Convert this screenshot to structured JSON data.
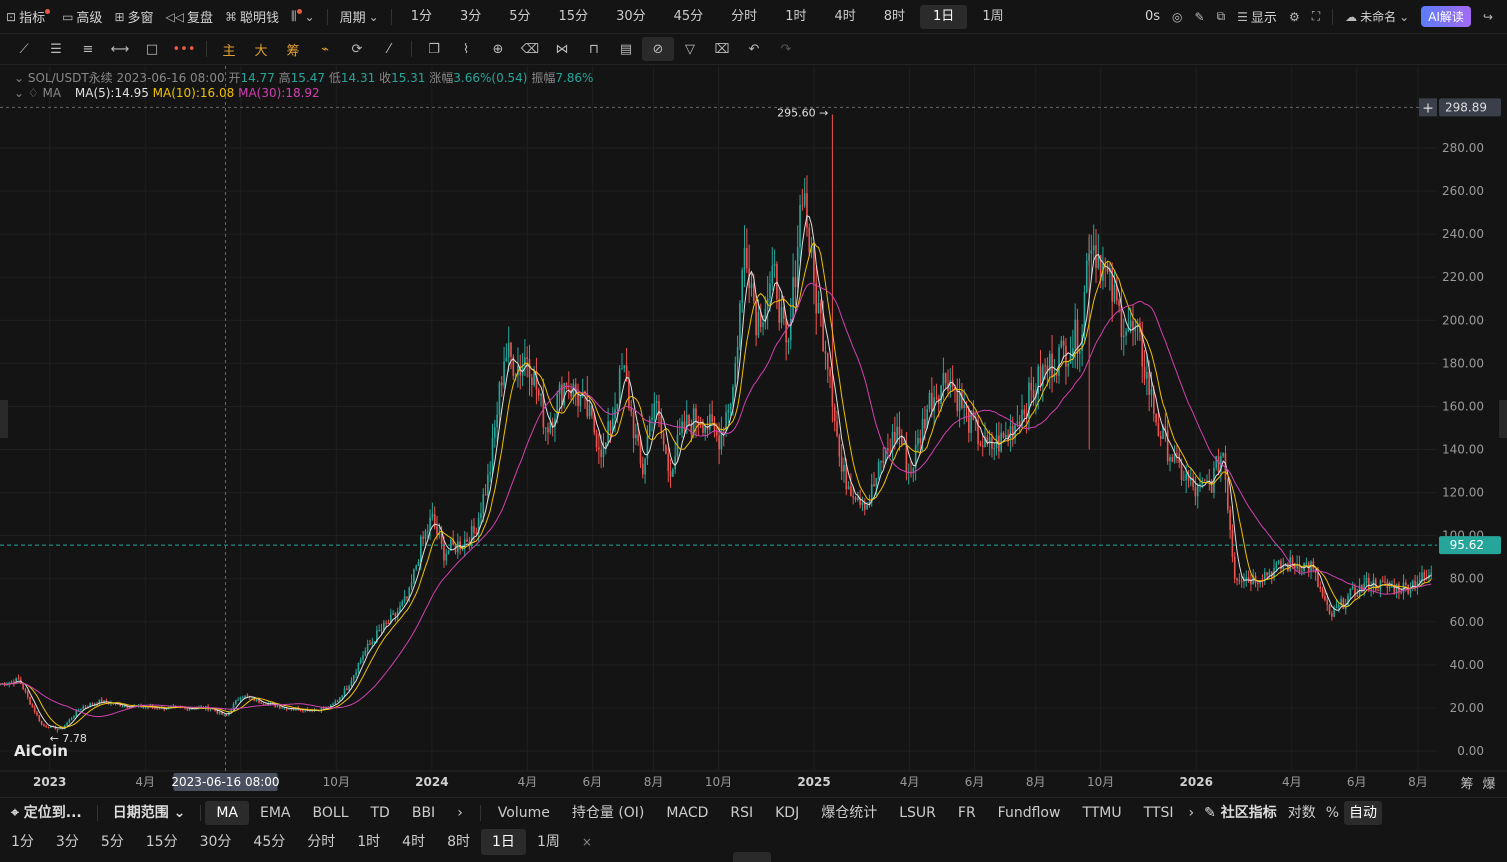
{
  "topbar": {
    "indicators": "指标",
    "advanced": "高级",
    "multi_window": "多窗",
    "replay": "复盘",
    "smart_money": "聪明钱",
    "period_menu": "周期",
    "periods": [
      "1分",
      "3分",
      "5分",
      "15分",
      "30分",
      "45分",
      "分时",
      "1时",
      "4时",
      "8时",
      "1日",
      "1周"
    ],
    "active_period": "1日",
    "countdown": "0s",
    "display": "显示",
    "layout_name": "未命名",
    "ai_button": "AI解读"
  },
  "drawbar": {
    "main_label": "主",
    "big_label": "大",
    "chip_label": "筹"
  },
  "legend": {
    "symbol": "SOL/USDT永续",
    "date": "2023-06-16 08:00",
    "open_label": "开",
    "open": "14.77",
    "high_label": "高",
    "high": "15.47",
    "low_label": "低",
    "low": "14.31",
    "close_label": "收",
    "close": "15.31",
    "change_label": "涨幅",
    "change": "3.66%(0.54)",
    "amp_label": "振幅",
    "amp": "7.86%",
    "ma_name": "MA",
    "ma5": "MA(5):14.95",
    "ma10": "MA(10):16.08",
    "ma30": "MA(30):18.92"
  },
  "chart_data": {
    "type": "line",
    "title": "SOL/USDT永续",
    "interval": "1日",
    "ylim": [
      0,
      300
    ],
    "y_ticks": [
      "0.00",
      "20.00",
      "40.00",
      "60.00",
      "80.00",
      "100.00",
      "120.00",
      "140.00",
      "160.00",
      "180.00",
      "200.00",
      "220.00",
      "240.00",
      "260.00",
      "280.00"
    ],
    "x_ticks": [
      "2023",
      "4月",
      "7月",
      "10月",
      "2024",
      "4月",
      "6月",
      "8月",
      "10月",
      "2025",
      "4月",
      "6月",
      "8月",
      "10月",
      "2026",
      "4月",
      "6月",
      "8月"
    ],
    "x_tick_dates": [
      2023.0,
      2023.25,
      2023.5,
      2023.75,
      2024.0,
      2024.25,
      2024.42,
      2024.58,
      2024.75,
      2025.0,
      2025.25,
      2025.42,
      2025.58,
      2025.75,
      2026.0,
      2026.25,
      2026.42,
      2026.58
    ],
    "x_range": [
      2022.87,
      2026.63
    ],
    "series": [
      {
        "name": "SOL/USDT永续",
        "color": "#26a69a",
        "x": [
          2022.87,
          2022.92,
          2022.95,
          2022.98,
          2023.03,
          2023.08,
          2023.13,
          2023.2,
          2023.3,
          2023.42,
          2023.46,
          2023.5,
          2023.55,
          2023.62,
          2023.7,
          2023.74,
          2023.78,
          2023.82,
          2023.86,
          2023.9,
          2023.94,
          2023.97,
          2024.0,
          2024.03,
          2024.07,
          2024.11,
          2024.15,
          2024.19,
          2024.23,
          2024.25,
          2024.3,
          2024.35,
          2024.4,
          2024.45,
          2024.5,
          2024.55,
          2024.58,
          2024.62,
          2024.66,
          2024.7,
          2024.75,
          2024.79,
          2024.82,
          2024.85,
          2024.88,
          2024.9,
          2024.93,
          2024.97,
          2025.0,
          2025.04,
          2025.07,
          2025.1,
          2025.14,
          2025.18,
          2025.22,
          2025.25,
          2025.3,
          2025.35,
          2025.4,
          2025.45,
          2025.5,
          2025.55,
          2025.6,
          2025.65,
          2025.7,
          2025.72,
          2025.75,
          2025.8,
          2025.85,
          2025.9,
          2025.95,
          2026.0,
          2026.04,
          2026.07,
          2026.1,
          2026.15,
          2026.2,
          2026.25,
          2026.3,
          2026.35,
          2026.4,
          2026.45,
          2026.5,
          2026.55,
          2026.58,
          2026.61,
          2026.63
        ],
        "y": [
          31,
          33,
          22,
          12,
          10,
          20,
          23,
          21,
          20,
          20,
          16,
          26,
          23,
          20,
          19,
          21,
          30,
          45,
          55,
          62,
          72,
          95,
          108,
          92,
          96,
          101,
          128,
          185,
          178,
          185,
          150,
          172,
          160,
          138,
          178,
          128,
          165,
          130,
          150,
          156,
          145,
          170,
          238,
          200,
          212,
          220,
          180,
          265,
          215,
          180,
          130,
          122,
          115,
          135,
          150,
          128,
          162,
          175,
          155,
          140,
          145,
          160,
          176,
          185,
          195,
          240,
          228,
          202,
          190,
          150,
          132,
          120,
          125,
          140,
          82,
          80,
          84,
          87,
          86,
          62,
          72,
          78,
          76,
          76,
          80,
          80,
          96
        ]
      },
      {
        "name": "MA(5)",
        "color": "#e0e0e0"
      },
      {
        "name": "MA(10)",
        "color": "#f0c000"
      },
      {
        "name": "MA(30)",
        "color": "#d040b0"
      }
    ],
    "annotations": {
      "high_label": "295.60",
      "low_label": "7.78",
      "current_price": "95.62",
      "crosshair_price": "298.89",
      "crosshair_date": "2023-06-16 08:00"
    },
    "logo": "AiCoin"
  },
  "bottom_indicators": {
    "locate": "定位到...",
    "date_range": "日期范围",
    "main": [
      "MA",
      "EMA",
      "BOLL",
      "TD",
      "BBI"
    ],
    "active_main": "MA",
    "sub": [
      "Volume",
      "持仓量 (OI)",
      "MACD",
      "RSI",
      "KDJ",
      "爆仓统计",
      "LSUR",
      "FR",
      "Fundflow",
      "TTMU",
      "TTSI"
    ],
    "community": "社区指标",
    "log": "对数",
    "percent": "%",
    "auto": "自动"
  },
  "bottom_periods": {
    "items": [
      "1分",
      "3分",
      "5分",
      "15分",
      "30分",
      "45分",
      "分时",
      "1时",
      "4时",
      "8时",
      "1日",
      "1周"
    ],
    "active": "1日",
    "close": "×"
  },
  "colors": {
    "up": "#26a69a",
    "down": "#ef5350",
    "ma5": "#e0e0e0",
    "ma10": "#f0c000",
    "ma30": "#d040b0"
  }
}
